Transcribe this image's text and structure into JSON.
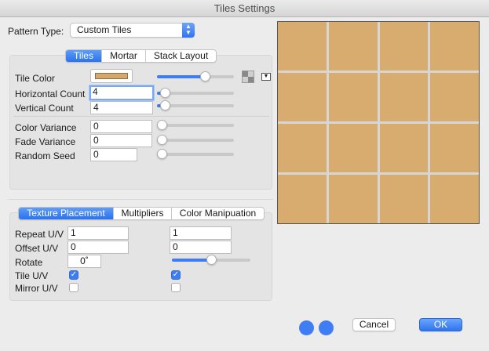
{
  "window": {
    "title": "Tiles Settings"
  },
  "pattern": {
    "label": "Pattern Type:",
    "value": "Custom Tiles"
  },
  "tile_tabs": [
    {
      "label": "Tiles",
      "active": true
    },
    {
      "label": "Mortar",
      "active": false
    },
    {
      "label": "Stack Layout",
      "active": false
    }
  ],
  "tiles": {
    "tile_color_label": "Tile Color",
    "tile_color": "#d8a86a",
    "tile_color_slider": 0.65,
    "horizontal_count_label": "Horizontal Count",
    "horizontal_count": "4",
    "horizontal_slider": 0.05,
    "vertical_count_label": "Vertical Count",
    "vertical_count": "4",
    "vertical_slider": 0.05,
    "color_variance_label": "Color Variance",
    "color_variance": "0",
    "color_variance_slider": 0,
    "fade_variance_label": "Fade Variance",
    "fade_variance": "0",
    "fade_variance_slider": 0,
    "random_seed_label": "Random Seed",
    "random_seed": "0",
    "random_seed_slider": 0
  },
  "texture_tabs": [
    {
      "label": "Texture Placement",
      "active": true
    },
    {
      "label": "Multipliers",
      "active": false
    },
    {
      "label": "Color Manipuation",
      "active": false
    }
  ],
  "texture": {
    "repeat_label": "Repeat U/V",
    "repeat_u": "1",
    "repeat_v": "1",
    "offset_label": "Offset U/V",
    "offset_u": "0",
    "offset_v": "0",
    "rotate_label": "Rotate",
    "rotate": "0˚",
    "rotate_slider": 0.5,
    "tile_label": "Tile U/V",
    "tile_u": true,
    "tile_v": true,
    "mirror_label": "Mirror U/V",
    "mirror_u": false,
    "mirror_v": false
  },
  "preview": {
    "tile_color": "#d8ac6e",
    "mortar_color": "#d6d6d6",
    "grid": 4
  },
  "buttons": {
    "cancel": "Cancel",
    "ok": "OK"
  },
  "colors": {
    "accent": "#3d7df0"
  }
}
